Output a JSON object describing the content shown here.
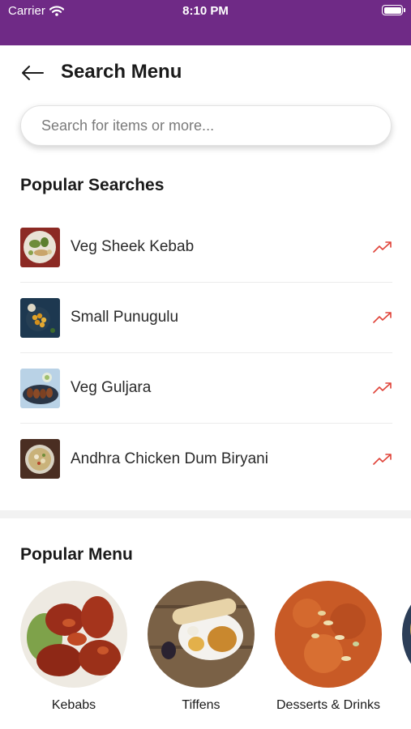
{
  "status_bar": {
    "carrier": "Carrier",
    "time": "8:10 PM"
  },
  "header": {
    "title": "Search Menu"
  },
  "search": {
    "placeholder": "Search for items or more..."
  },
  "popular_searches": {
    "title": "Popular Searches",
    "items": [
      {
        "label": "Veg Sheek Kebab"
      },
      {
        "label": "Small Punugulu"
      },
      {
        "label": "Veg Guljara"
      },
      {
        "label": "Andhra Chicken Dum Biryani"
      }
    ]
  },
  "popular_menu": {
    "title": "Popular Menu",
    "items": [
      {
        "label": "Kebabs"
      },
      {
        "label": "Tiffens"
      },
      {
        "label": "Desserts & Drinks"
      }
    ]
  },
  "colors": {
    "status_bar": "#6f2a86",
    "trend_icon": "#e0443a"
  }
}
